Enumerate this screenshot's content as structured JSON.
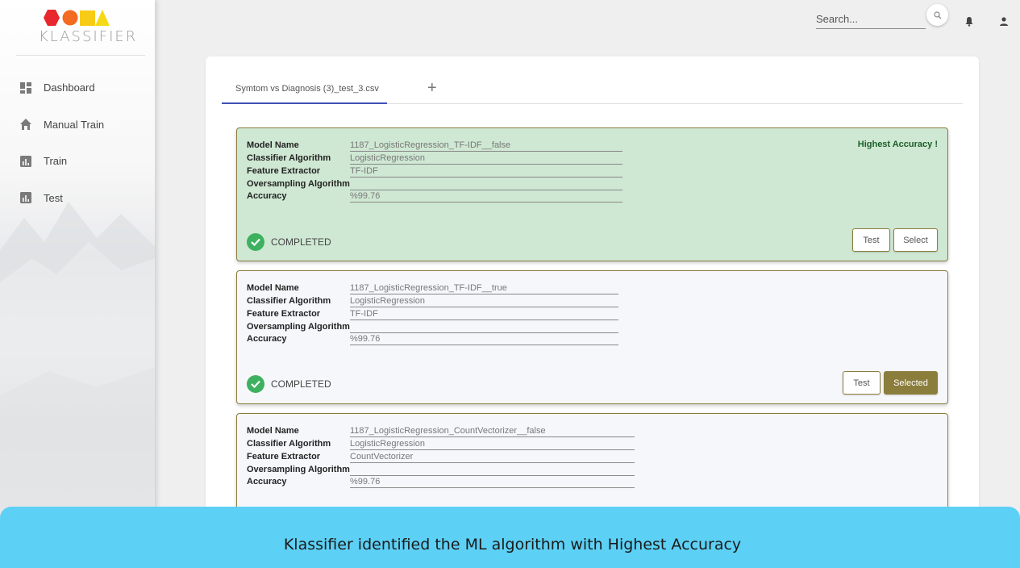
{
  "app": {
    "brand": "KLASSIFIER",
    "logo_colors": [
      "#e8262d",
      "#f26b21",
      "#f8cc16",
      "#f6d916"
    ]
  },
  "sidebar": {
    "items": [
      {
        "label": "Dashboard",
        "icon": "dashboard-icon"
      },
      {
        "label": "Manual Train",
        "icon": "home-icon"
      },
      {
        "label": "Train",
        "icon": "bar-chart-icon"
      },
      {
        "label": "Test",
        "icon": "bar-chart-icon"
      }
    ]
  },
  "header": {
    "search_placeholder": "Search...",
    "icons": [
      "search-icon",
      "bell-icon",
      "user-icon"
    ]
  },
  "tabs": {
    "items": [
      {
        "label": "Symtom vs Diagnosis (3)_test_3.csv",
        "active": true
      }
    ],
    "add_label": "+"
  },
  "field_labels": {
    "model_name": "Model Name",
    "classifier": "Classifier Algorithm",
    "feature": "Feature Extractor",
    "oversampling": "Oversampling Algorithm",
    "accuracy": "Accuracy"
  },
  "cards": [
    {
      "model_name": "1187_LogisticRegression_TF-IDF__false",
      "classifier": "LogisticRegression",
      "feature": "TF-IDF",
      "oversampling": "",
      "accuracy": "%99.76",
      "status": "COMPLETED",
      "badge": "Highest Accuracy !",
      "test_label": "Test",
      "select_label": "Select",
      "selected": false
    },
    {
      "model_name": "1187_LogisticRegression_TF-IDF__true",
      "classifier": "LogisticRegression",
      "feature": "TF-IDF",
      "oversampling": "",
      "accuracy": "%99.76",
      "status": "COMPLETED",
      "badge": "",
      "test_label": "Test",
      "select_label": "Selected",
      "selected": true
    },
    {
      "model_name": "1187_LogisticRegression_CountVectorizer__false",
      "classifier": "LogisticRegression",
      "feature": "CountVectorizer",
      "oversampling": "",
      "accuracy": "%99.76",
      "status": "",
      "badge": "",
      "test_label": "",
      "select_label": "",
      "selected": false
    }
  ],
  "banner": {
    "text": "Klassifier identified the ML algorithm with Highest Accuracy",
    "color": "#5dd0f5"
  },
  "colors": {
    "best_card": "#cfe8d3",
    "accent_button": "#8b7d3b",
    "success": "#3db15f",
    "tab_underline": "#3f51b5"
  }
}
